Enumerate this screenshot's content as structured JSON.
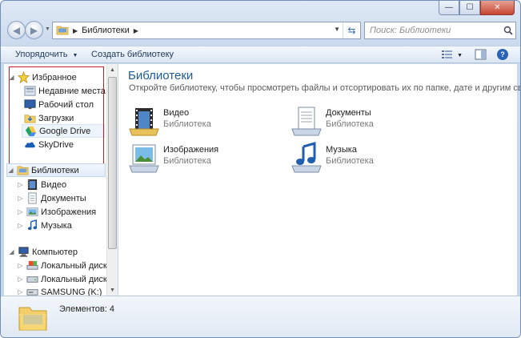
{
  "window": {
    "caption_minimize": "—",
    "caption_maximize": "☐",
    "caption_close": "✕"
  },
  "address_bar": {
    "breadcrumb": "Библиотеки"
  },
  "search": {
    "placeholder": "Поиск: Библиотеки"
  },
  "toolbar": {
    "organize_label": "Упорядочить",
    "create_library_label": "Создать библиотеку"
  },
  "nav": {
    "favorites": {
      "label": "Избранное",
      "items": [
        {
          "label": "Недавние места",
          "icon": "recent-places-icon"
        },
        {
          "label": "Рабочий стол",
          "icon": "desktop-icon"
        },
        {
          "label": "Загрузки",
          "icon": "downloads-icon"
        },
        {
          "label": "Google Drive",
          "icon": "google-drive-icon"
        },
        {
          "label": "SkyDrive",
          "icon": "skydrive-icon"
        }
      ]
    },
    "libraries": {
      "label": "Библиотеки",
      "items": [
        {
          "label": "Видео",
          "icon": "video-library-icon"
        },
        {
          "label": "Документы",
          "icon": "documents-library-icon"
        },
        {
          "label": "Изображения",
          "icon": "pictures-library-icon"
        },
        {
          "label": "Музыка",
          "icon": "music-library-icon"
        }
      ]
    },
    "computer": {
      "label": "Компьютер",
      "items": [
        {
          "label": "Локальный диск (C",
          "icon": "drive-c-icon"
        },
        {
          "label": "Локальный диск (D",
          "icon": "drive-d-icon"
        },
        {
          "label": "SAMSUNG (K:)",
          "icon": "usb-drive-icon"
        }
      ]
    }
  },
  "main": {
    "title": "Библиотеки",
    "description": "Откройте библиотеку, чтобы просмотреть файлы и отсортировать их по папке, дате и другим свойств...",
    "libraries": [
      {
        "name": "Видео",
        "kind": "Библиотека",
        "icon": "video-library-icon"
      },
      {
        "name": "Документы",
        "kind": "Библиотека",
        "icon": "documents-library-icon"
      },
      {
        "name": "Изображения",
        "kind": "Библиотека",
        "icon": "pictures-library-icon"
      },
      {
        "name": "Музыка",
        "kind": "Библиотека",
        "icon": "music-library-icon"
      }
    ]
  },
  "details": {
    "count": "Элементов: 4"
  },
  "colors": {
    "highlight_border": "#c72027",
    "title_blue": "#1e5a96",
    "help_blue": "#2a63b8"
  }
}
